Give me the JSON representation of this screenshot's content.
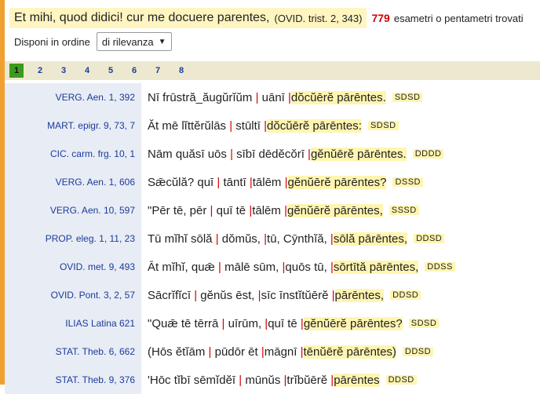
{
  "query": {
    "text": "Et mihi, quod didici! cur me docuere parentes,",
    "ref": "(OVID. trist. 2, 343)",
    "count": "779",
    "tail": "esametri o pentametri trovati"
  },
  "sort": {
    "label": "Disponi in ordine",
    "selected": "di rilevanza"
  },
  "pages": [
    "1",
    "2",
    "3",
    "4",
    "5",
    "6",
    "7",
    "8"
  ],
  "results": [
    {
      "ref": "VERG. Aen. 1, 392",
      "pre": "Nī frūstrā̆_ăugŭrĭŭm ",
      "mid": " uānī ",
      "hl": "dŏcŭērĕ pārēntes.",
      "meter": "SDSD"
    },
    {
      "ref": "MART. epigr. 9, 73, 7",
      "pre": "Ăt mē lĭttĕrŭlās ",
      "mid": " stūltī ",
      "hl": "dŏcŭērĕ pārēntes:",
      "meter": "SDSD"
    },
    {
      "ref": "CIC. carm. frg. 10, 1",
      "pre": "Nām quăsī uōs ",
      "mid": " sībī dēdĕcŏrī ",
      "hl": "gĕnŭērĕ pārēntes.",
      "meter": "DDDD"
    },
    {
      "ref": "VERG. Aen. 1, 606",
      "pre": "Sǣcŭlă? quī ",
      "mid": " tāntī ",
      "hl": "tālēm ",
      "hl2": "gĕnŭērĕ pārēntes?",
      "meter": "DSSD"
    },
    {
      "ref": "VERG. Aen. 10, 597",
      "pre": "\"Pēr tē, pēr ",
      "mid": " quī tē ",
      "hl": "tālēm ",
      "hl2": "gĕnŭērĕ pārēntes,",
      "meter": "SSSD"
    },
    {
      "ref": "PROP. eleg. 1, 11, 23",
      "pre": "Tū mĭhĭ sōlă ",
      "mid": " dŏmŭs, ",
      "hl": "tū, Cȳnthĭă, ",
      "hl2": "sōlă pārēntes,",
      "meter": "DDSD"
    },
    {
      "ref": "OVID. met. 9, 493",
      "pre": "Āt mĭhĭ, quǣ ",
      "mid": " mālē sūm, ",
      "hl": "quōs tū, ",
      "hl2": "sōrtītă pārēntes,",
      "meter": "DDSS"
    },
    {
      "ref": "OVID. Pont. 3, 2, 57",
      "pre": "Sācrĭfĭcī ",
      "mid": " gĕnŭs ēst, ",
      "hl": "sīc īnstĭtŭērĕ ",
      "hl2": "pārēntes,",
      "meter": "DDSD"
    },
    {
      "ref": "ILIAS Latina 621",
      "pre": "\"Quǣ tē tērrā ",
      "mid": " uīrūm, ",
      "hl": "quī tē ",
      "hl2": "gĕnŭērĕ pārēntes?",
      "meter": "SDSD"
    },
    {
      "ref": "STAT. Theb. 6, 662",
      "pre": "(Hōs ĕtĭām ",
      "mid": " pūdōr ēt ",
      "hl": "māgnī ",
      "hl2": "tēnŭērĕ pārēntes)",
      "meter": "DDSD"
    },
    {
      "ref": "STAT. Theb. 9, 376",
      "pre": "'Hōc tĭbī sēmĭdĕī ",
      "mid": " mūnŭs ",
      "hl": "trĭbŭērĕ ",
      "hl2": "pārēntes",
      "meter": "DDSD"
    }
  ]
}
